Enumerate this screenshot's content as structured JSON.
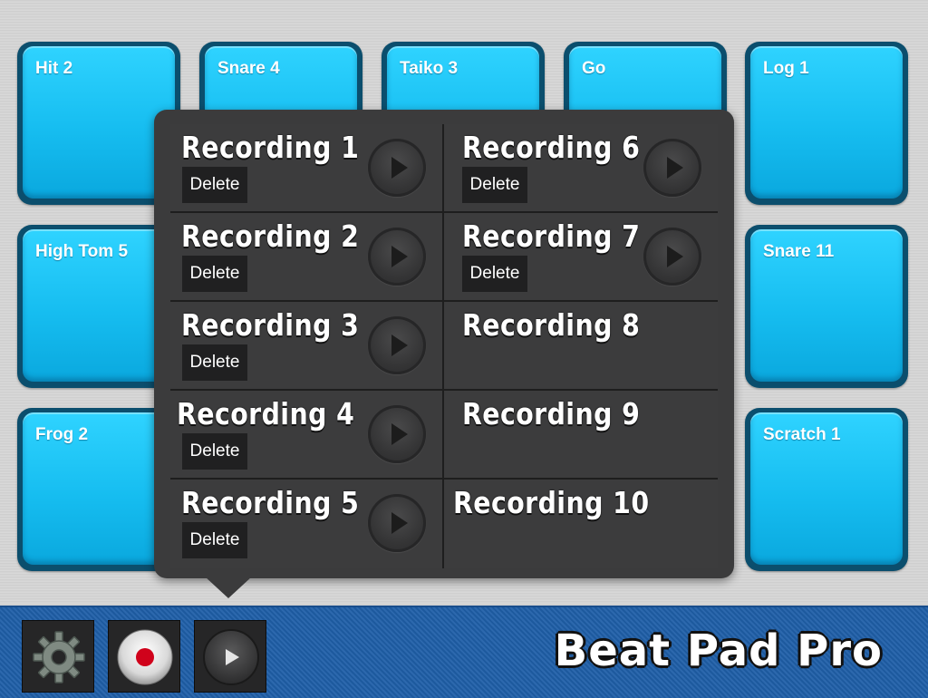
{
  "app": {
    "title": "Beat Pad Pro"
  },
  "pads": [
    {
      "label": "Hit 2"
    },
    {
      "label": "Snare 4"
    },
    {
      "label": "Taiko 3"
    },
    {
      "label": "Go"
    },
    {
      "label": "Log 1"
    },
    {
      "label": "High Tom 5"
    },
    {
      "label": "Snare 11"
    },
    {
      "label": "Frog 2"
    },
    {
      "label": "Scratch 1"
    }
  ],
  "recordings": [
    {
      "title": "Recording 1",
      "delete_label": "Delete"
    },
    {
      "title": "Recording 2",
      "delete_label": "Delete"
    },
    {
      "title": "Recording 3",
      "delete_label": "Delete"
    },
    {
      "title": "Recording 4",
      "delete_label": "Delete"
    },
    {
      "title": "Recording 5",
      "delete_label": "Delete"
    },
    {
      "title": "Recording 6",
      "delete_label": "Delete"
    },
    {
      "title": "Recording 7",
      "delete_label": "Delete"
    },
    {
      "title": "Recording 8"
    },
    {
      "title": "Recording 9"
    },
    {
      "title": "Recording 10"
    }
  ],
  "toolbar": {
    "buttons": [
      {
        "icon": "gear-icon"
      },
      {
        "icon": "record-icon"
      },
      {
        "icon": "play-icon"
      }
    ]
  },
  "colors": {
    "pad": "#16bdf0",
    "popover": "#3b3b3c",
    "bottom_bar": "#1f5fa8",
    "record_red": "#d0021b"
  }
}
